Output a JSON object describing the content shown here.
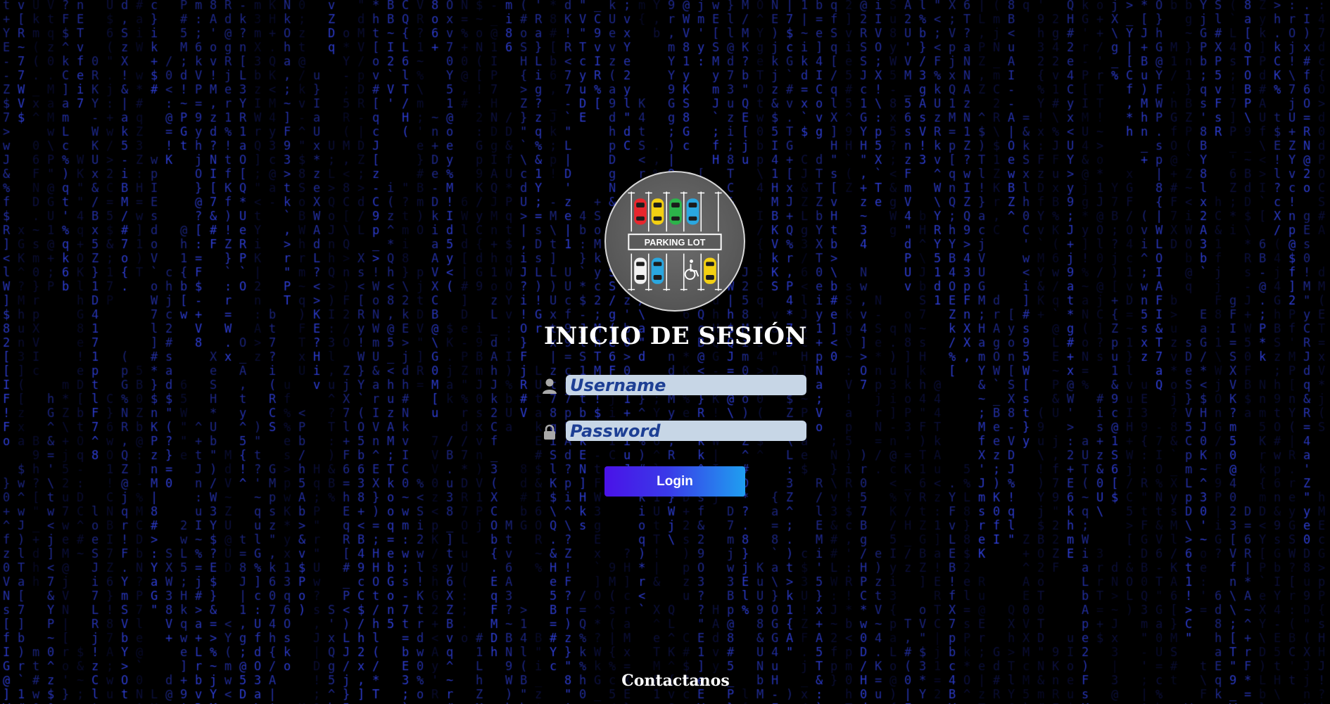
{
  "background": {
    "effect": "matrix-rain",
    "glyph_color": "#2f3fd8",
    "glyph_color_dim": "#1c248a",
    "background_color": "#000000"
  },
  "logo": {
    "label": "PARKING LOT",
    "icon": "parking-lot-logo",
    "car_colors": {
      "red": "#e8262d",
      "yellow": "#f3d012",
      "green": "#2cb34a",
      "blue": "#2aa7e0",
      "white": "#f2f2f2"
    },
    "accessibility_icon": "wheelchair-icon"
  },
  "title": "INICIO DE SESIÓN",
  "username": {
    "icon": "user-icon",
    "placeholder": "Username",
    "value": ""
  },
  "password": {
    "icon": "lock-icon",
    "placeholder": "Password",
    "value": ""
  },
  "login_button": {
    "label": "Login",
    "gradient_start": "#4a12e8",
    "gradient_end": "#1f9ff0"
  },
  "footer": {
    "contact_label": "Contactanos"
  }
}
